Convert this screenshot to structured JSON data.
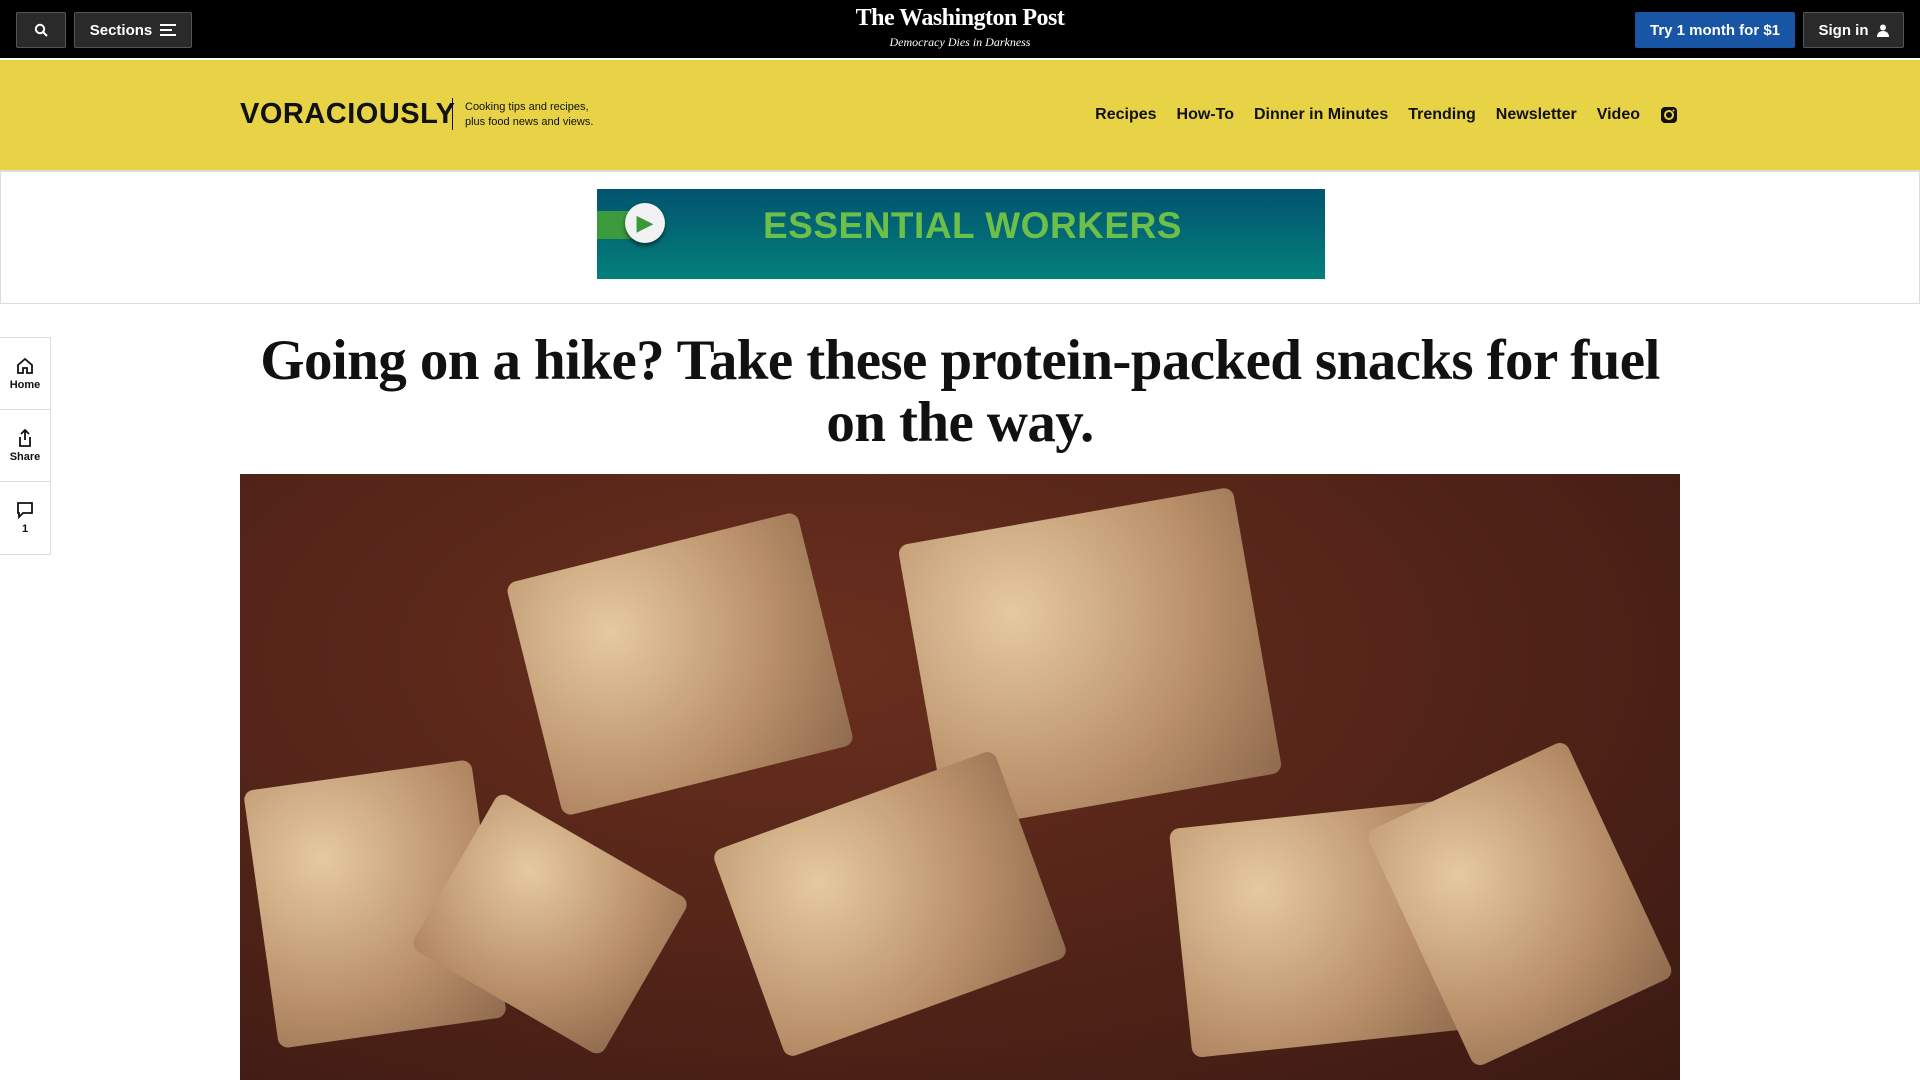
{
  "topbar": {
    "sections_label": "Sections",
    "brand": "The Washington Post",
    "tagline": "Democracy Dies in Darkness",
    "trial_label": "Try 1 month for $1",
    "signin_label": "Sign in"
  },
  "section_header": {
    "logo": "VORACIOUSLY",
    "tagline_1": "Cooking tips and recipes,",
    "tagline_2": "plus food news and views.",
    "nav": [
      "Recipes",
      "How-To",
      "Dinner in Minutes",
      "Trending",
      "Newsletter",
      "Video"
    ]
  },
  "ad": {
    "text": "ESSENTIAL WORKERS"
  },
  "rail": {
    "home": "Home",
    "share": "Share",
    "comments": "1"
  },
  "article": {
    "headline": "Going on a hike? Take these protein-packed snacks for fuel on the way."
  },
  "colors": {
    "band": "#e8d346",
    "trial": "#1955a5"
  }
}
